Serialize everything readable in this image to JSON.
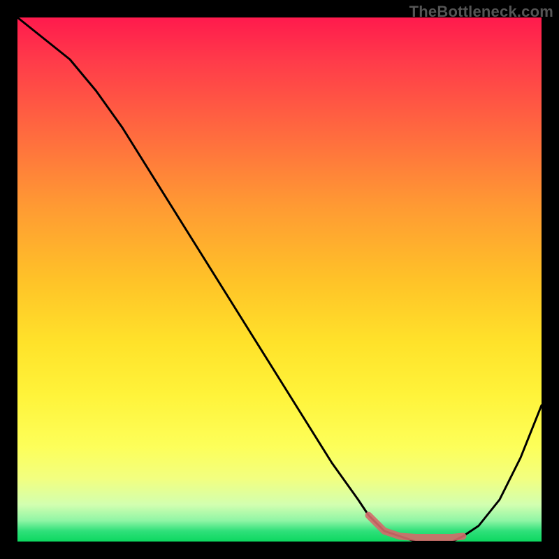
{
  "watermark": "TheBottleneck.com",
  "chart_data": {
    "type": "line",
    "title": "",
    "xlabel": "",
    "ylabel": "",
    "xlim": [
      0,
      100
    ],
    "ylim": [
      0,
      100
    ],
    "x": [
      0,
      5,
      10,
      15,
      20,
      25,
      30,
      35,
      40,
      45,
      50,
      55,
      60,
      65,
      67,
      70,
      73,
      76,
      80,
      83,
      85,
      88,
      92,
      96,
      100
    ],
    "values": [
      100,
      96,
      92,
      86,
      79,
      71,
      63,
      55,
      47,
      39,
      31,
      23,
      15,
      8,
      5,
      2,
      1,
      0,
      0,
      0,
      1,
      3,
      8,
      16,
      26
    ],
    "highlight_band": {
      "x_start": 67,
      "x_end": 85,
      "y": 2
    },
    "gradient_stops": [
      {
        "pos": 0,
        "color": "#ff1a4d"
      },
      {
        "pos": 50,
        "color": "#ffc228"
      },
      {
        "pos": 82,
        "color": "#fdff5a"
      },
      {
        "pos": 100,
        "color": "#0cd860"
      }
    ]
  }
}
